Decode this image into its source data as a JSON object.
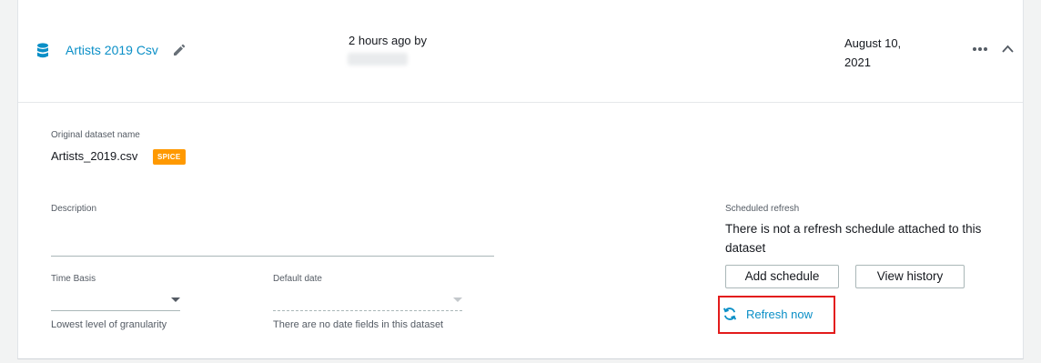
{
  "dataset": {
    "name": "Artists 2019 Csv",
    "updated_text": "2 hours ago by",
    "created_date": "August 10, 2021",
    "icon": "database-icon"
  },
  "details": {
    "original_label": "Original dataset name",
    "original_name": "Artists_2019.csv",
    "badge": "SPICE",
    "description_label": "Description",
    "time_basis": {
      "label": "Time Basis",
      "value": "",
      "help": "Lowest level of granularity"
    },
    "default_date": {
      "label": "Default date",
      "value": "",
      "help": "There are no date fields in this dataset"
    }
  },
  "schedule": {
    "label": "Scheduled refresh",
    "text": "There is not a refresh schedule attached to this dataset",
    "add_button": "Add schedule",
    "history_button": "View history",
    "refresh_now": "Refresh now"
  },
  "colors": {
    "link": "#0a8fc7",
    "badge": "#ff9900",
    "highlight": "#e31b1b"
  }
}
